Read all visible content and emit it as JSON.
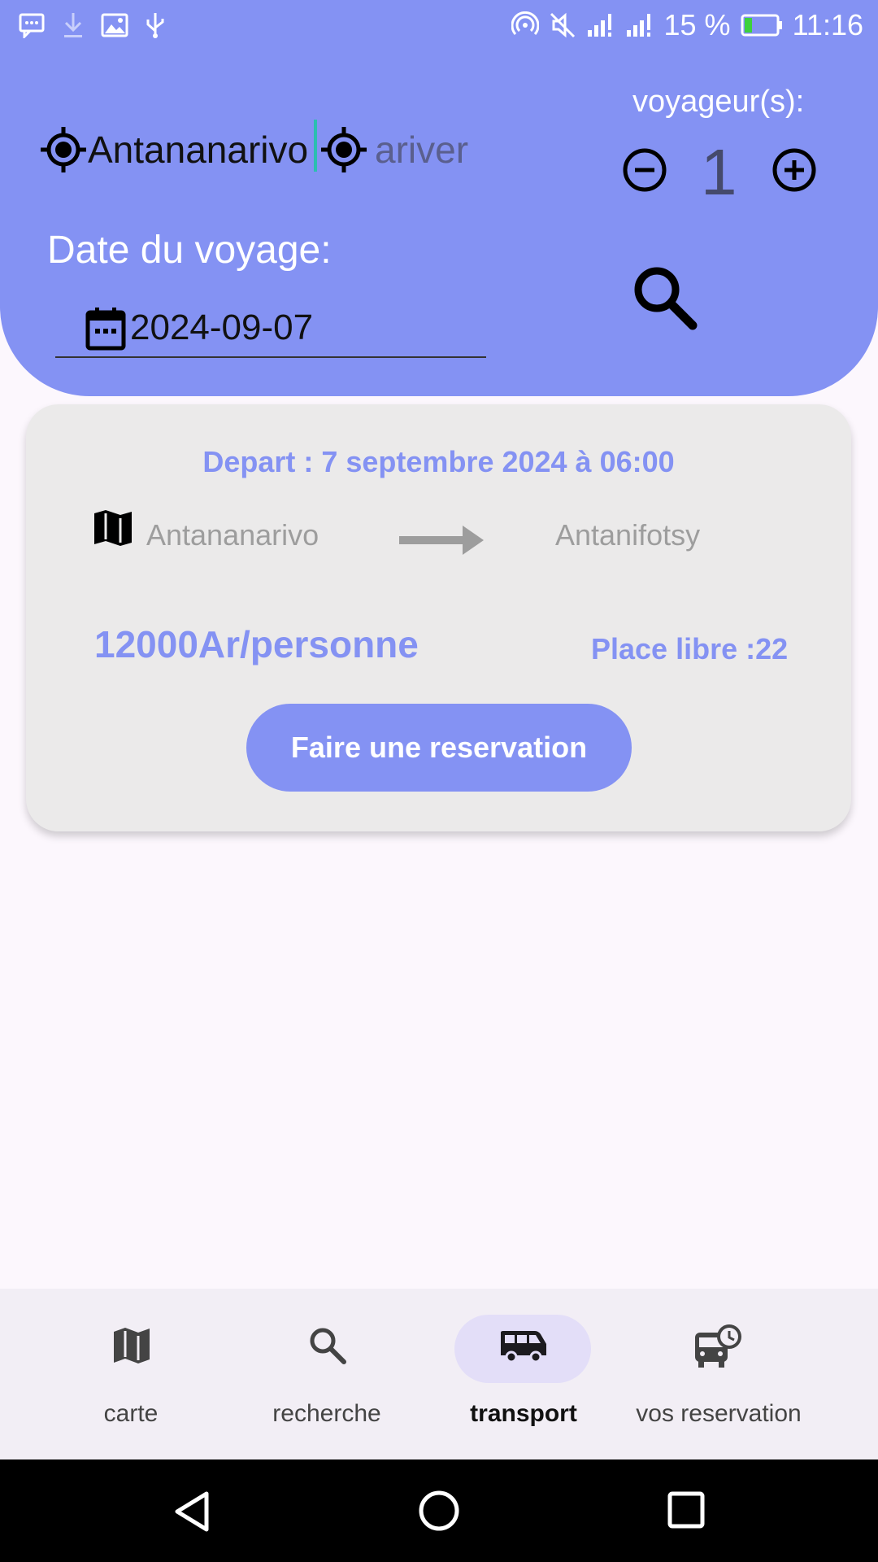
{
  "status_bar": {
    "battery_percent": "15 %",
    "time": "11:16"
  },
  "search": {
    "departure_value": "Antananarivo",
    "arrival_placeholder": "ariver",
    "travelers_label": "voyageur(s):",
    "travelers_count": "1",
    "date_label": "Date du voyage:",
    "date_value": "2024-09-07"
  },
  "result": {
    "depart_text": "Depart : 7 septembre 2024 à 06:00",
    "from": "Antananarivo",
    "to": "Antanifotsy",
    "price": "12000Ar/personne",
    "places": "Place libre :22",
    "reserve_label": "Faire une reservation"
  },
  "bottom_nav": {
    "items": [
      {
        "label": "carte",
        "icon": "map-icon",
        "active": false
      },
      {
        "label": "recherche",
        "icon": "search-icon",
        "active": false
      },
      {
        "label": "transport",
        "icon": "bus-icon",
        "active": true
      },
      {
        "label": "vos reservation",
        "icon": "bus-clock-icon",
        "active": false
      }
    ]
  },
  "colors": {
    "accent": "#8492f3",
    "card_bg": "#ebeaea",
    "active_pill": "#e3def8"
  }
}
